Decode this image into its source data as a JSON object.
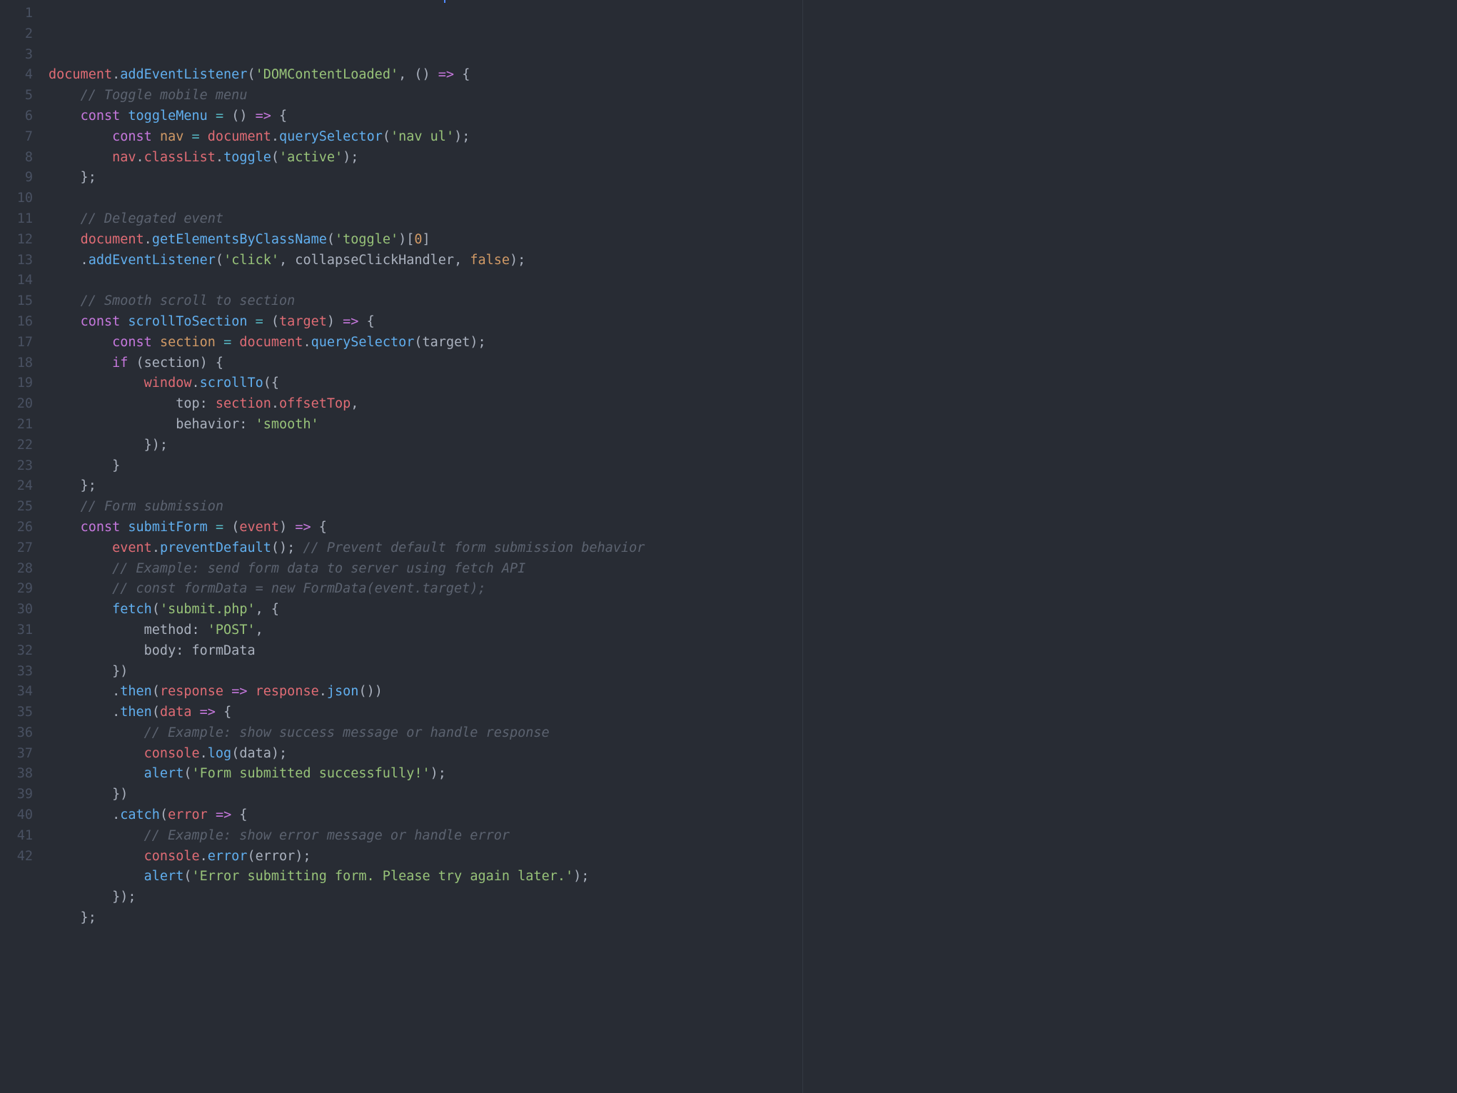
{
  "lines": [
    {
      "n": "1",
      "tokens": [
        [
          "document",
          "t-red"
        ],
        [
          ".",
          "t-punc"
        ],
        [
          "addEventListener",
          "t-blue"
        ],
        [
          "(",
          "t-punc"
        ],
        [
          "'DOMContentLoaded'",
          "t-green"
        ],
        [
          ", () ",
          "t-gray"
        ],
        [
          "=>",
          "t-purple"
        ],
        [
          " {",
          "t-gray"
        ]
      ]
    },
    {
      "n": "2",
      "tokens": [
        [
          "    ",
          "t-gray"
        ],
        [
          "// Toggle mobile menu",
          "t-comment"
        ]
      ]
    },
    {
      "n": "3",
      "tokens": [
        [
          "    ",
          "t-gray"
        ],
        [
          "const",
          "t-purple"
        ],
        [
          " ",
          "t-gray"
        ],
        [
          "toggleMenu",
          "t-blue"
        ],
        [
          " ",
          "t-gray"
        ],
        [
          "=",
          "t-cyan"
        ],
        [
          " () ",
          "t-gray"
        ],
        [
          "=>",
          "t-purple"
        ],
        [
          " {",
          "t-gray"
        ]
      ]
    },
    {
      "n": "4",
      "tokens": [
        [
          "        ",
          "t-gray"
        ],
        [
          "const",
          "t-purple"
        ],
        [
          " ",
          "t-gray"
        ],
        [
          "nav",
          "t-orange"
        ],
        [
          " ",
          "t-gray"
        ],
        [
          "=",
          "t-cyan"
        ],
        [
          " ",
          "t-gray"
        ],
        [
          "document",
          "t-red"
        ],
        [
          ".",
          "t-punc"
        ],
        [
          "querySelector",
          "t-blue"
        ],
        [
          "(",
          "t-punc"
        ],
        [
          "'nav ul'",
          "t-green"
        ],
        [
          ");",
          "t-punc"
        ]
      ]
    },
    {
      "n": "5",
      "tokens": [
        [
          "        ",
          "t-gray"
        ],
        [
          "nav",
          "t-red"
        ],
        [
          ".",
          "t-punc"
        ],
        [
          "classList",
          "t-red"
        ],
        [
          ".",
          "t-punc"
        ],
        [
          "toggle",
          "t-blue"
        ],
        [
          "(",
          "t-punc"
        ],
        [
          "'active'",
          "t-green"
        ],
        [
          ");",
          "t-punc"
        ]
      ]
    },
    {
      "n": "6",
      "tokens": [
        [
          "    };",
          "t-gray"
        ]
      ]
    },
    {
      "n": "7",
      "tokens": [
        [
          "",
          "t-gray"
        ]
      ]
    },
    {
      "n": "8",
      "tokens": [
        [
          "    ",
          "t-gray"
        ],
        [
          "// Delegated event",
          "t-comment"
        ]
      ]
    },
    {
      "n": "9",
      "tokens": [
        [
          "    ",
          "t-gray"
        ],
        [
          "document",
          "t-red"
        ],
        [
          ".",
          "t-punc"
        ],
        [
          "getElementsByClassName",
          "t-blue"
        ],
        [
          "(",
          "t-punc"
        ],
        [
          "'toggle'",
          "t-green"
        ],
        [
          ")[",
          "t-punc"
        ],
        [
          "0",
          "t-orange"
        ],
        [
          "]",
          "t-punc"
        ]
      ]
    },
    {
      "n": "10",
      "tokens": [
        [
          "    .",
          "t-gray"
        ],
        [
          "addEventListener",
          "t-blue"
        ],
        [
          "(",
          "t-punc"
        ],
        [
          "'click'",
          "t-green"
        ],
        [
          ", collapseClickHandler, ",
          "t-gray"
        ],
        [
          "false",
          "t-orange"
        ],
        [
          ");",
          "t-punc"
        ]
      ]
    },
    {
      "n": "11",
      "tokens": [
        [
          "",
          "t-gray"
        ]
      ]
    },
    {
      "n": "12",
      "tokens": [
        [
          "    ",
          "t-gray"
        ],
        [
          "// Smooth scroll to section",
          "t-comment"
        ]
      ]
    },
    {
      "n": "13",
      "tokens": [
        [
          "    ",
          "t-gray"
        ],
        [
          "const",
          "t-purple"
        ],
        [
          " ",
          "t-gray"
        ],
        [
          "scrollToSection",
          "t-blue"
        ],
        [
          " ",
          "t-gray"
        ],
        [
          "=",
          "t-cyan"
        ],
        [
          " (",
          "t-gray"
        ],
        [
          "target",
          "t-red"
        ],
        [
          ") ",
          "t-gray"
        ],
        [
          "=>",
          "t-purple"
        ],
        [
          " {",
          "t-gray"
        ]
      ]
    },
    {
      "n": "14",
      "tokens": [
        [
          "        ",
          "t-gray"
        ],
        [
          "const",
          "t-purple"
        ],
        [
          " ",
          "t-gray"
        ],
        [
          "section",
          "t-orange"
        ],
        [
          " ",
          "t-gray"
        ],
        [
          "=",
          "t-cyan"
        ],
        [
          " ",
          "t-gray"
        ],
        [
          "document",
          "t-red"
        ],
        [
          ".",
          "t-punc"
        ],
        [
          "querySelector",
          "t-blue"
        ],
        [
          "(target);",
          "t-gray"
        ]
      ]
    },
    {
      "n": "15",
      "tokens": [
        [
          "        ",
          "t-gray"
        ],
        [
          "if",
          "t-purple"
        ],
        [
          " (section) {",
          "t-gray"
        ]
      ]
    },
    {
      "n": "16",
      "tokens": [
        [
          "            ",
          "t-gray"
        ],
        [
          "window",
          "t-red"
        ],
        [
          ".",
          "t-punc"
        ],
        [
          "scrollTo",
          "t-blue"
        ],
        [
          "({",
          "t-gray"
        ]
      ]
    },
    {
      "n": "17",
      "tokens": [
        [
          "                top: ",
          "t-gray"
        ],
        [
          "section",
          "t-red"
        ],
        [
          ".",
          "t-punc"
        ],
        [
          "offsetTop",
          "t-red"
        ],
        [
          ",",
          "t-punc"
        ]
      ]
    },
    {
      "n": "18",
      "tokens": [
        [
          "                behavior: ",
          "t-gray"
        ],
        [
          "'smooth'",
          "t-green"
        ]
      ]
    },
    {
      "n": "19",
      "tokens": [
        [
          "            });",
          "t-gray"
        ]
      ]
    },
    {
      "n": "20",
      "tokens": [
        [
          "        }",
          "t-gray"
        ]
      ]
    },
    {
      "n": "21",
      "tokens": [
        [
          "    };",
          "t-gray"
        ]
      ]
    },
    {
      "n": "22",
      "tokens": [
        [
          "    ",
          "t-gray"
        ],
        [
          "// Form submission",
          "t-comment"
        ]
      ]
    },
    {
      "n": "23",
      "tokens": [
        [
          "    ",
          "t-gray"
        ],
        [
          "const",
          "t-purple"
        ],
        [
          " ",
          "t-gray"
        ],
        [
          "submitForm",
          "t-blue"
        ],
        [
          " ",
          "t-gray"
        ],
        [
          "=",
          "t-cyan"
        ],
        [
          " (",
          "t-gray"
        ],
        [
          "event",
          "t-red"
        ],
        [
          ") ",
          "t-gray"
        ],
        [
          "=>",
          "t-purple"
        ],
        [
          " {",
          "t-gray"
        ]
      ]
    },
    {
      "n": "24",
      "tokens": [
        [
          "        ",
          "t-gray"
        ],
        [
          "event",
          "t-red"
        ],
        [
          ".",
          "t-punc"
        ],
        [
          "preventDefault",
          "t-blue"
        ],
        [
          "(); ",
          "t-gray"
        ],
        [
          "// Prevent default form submission behavior",
          "t-comment"
        ]
      ]
    },
    {
      "n": "25",
      "tokens": [
        [
          "        ",
          "t-gray"
        ],
        [
          "// Example: send form data to server using fetch API",
          "t-comment"
        ]
      ]
    },
    {
      "n": "26",
      "tokens": [
        [
          "        ",
          "t-gray"
        ],
        [
          "// const formData = new FormData(event.target);",
          "t-comment"
        ]
      ]
    },
    {
      "n": "27",
      "tokens": [
        [
          "        ",
          "t-gray"
        ],
        [
          "fetch",
          "t-blue"
        ],
        [
          "(",
          "t-punc"
        ],
        [
          "'submit.php'",
          "t-green"
        ],
        [
          ", {",
          "t-gray"
        ]
      ]
    },
    {
      "n": "28",
      "tokens": [
        [
          "            method: ",
          "t-gray"
        ],
        [
          "'POST'",
          "t-green"
        ],
        [
          ",",
          "t-punc"
        ]
      ]
    },
    {
      "n": "29",
      "tokens": [
        [
          "            body: formData",
          "t-gray"
        ]
      ]
    },
    {
      "n": "30",
      "tokens": [
        [
          "        })",
          "t-gray"
        ]
      ]
    },
    {
      "n": "31",
      "tokens": [
        [
          "        .",
          "t-gray"
        ],
        [
          "then",
          "t-blue"
        ],
        [
          "(",
          "t-punc"
        ],
        [
          "response",
          "t-red"
        ],
        [
          " ",
          "t-gray"
        ],
        [
          "=>",
          "t-purple"
        ],
        [
          " ",
          "t-gray"
        ],
        [
          "response",
          "t-red"
        ],
        [
          ".",
          "t-punc"
        ],
        [
          "json",
          "t-blue"
        ],
        [
          "())",
          "t-gray"
        ]
      ]
    },
    {
      "n": "32",
      "tokens": [
        [
          "        .",
          "t-gray"
        ],
        [
          "then",
          "t-blue"
        ],
        [
          "(",
          "t-punc"
        ],
        [
          "data",
          "t-red"
        ],
        [
          " ",
          "t-gray"
        ],
        [
          "=>",
          "t-purple"
        ],
        [
          " {",
          "t-gray"
        ]
      ]
    },
    {
      "n": "33",
      "tokens": [
        [
          "            ",
          "t-gray"
        ],
        [
          "// Example: show success message or handle response",
          "t-comment"
        ]
      ]
    },
    {
      "n": "34",
      "tokens": [
        [
          "            ",
          "t-gray"
        ],
        [
          "console",
          "t-red"
        ],
        [
          ".",
          "t-punc"
        ],
        [
          "log",
          "t-blue"
        ],
        [
          "(data);",
          "t-gray"
        ]
      ]
    },
    {
      "n": "35",
      "tokens": [
        [
          "            ",
          "t-gray"
        ],
        [
          "alert",
          "t-blue"
        ],
        [
          "(",
          "t-punc"
        ],
        [
          "'Form submitted successfully!'",
          "t-green"
        ],
        [
          ");",
          "t-punc"
        ]
      ]
    },
    {
      "n": "36",
      "tokens": [
        [
          "        })",
          "t-gray"
        ]
      ]
    },
    {
      "n": "37",
      "tokens": [
        [
          "        .",
          "t-gray"
        ],
        [
          "catch",
          "t-blue"
        ],
        [
          "(",
          "t-punc"
        ],
        [
          "error",
          "t-red"
        ],
        [
          " ",
          "t-gray"
        ],
        [
          "=>",
          "t-purple"
        ],
        [
          " {",
          "t-gray"
        ]
      ]
    },
    {
      "n": "38",
      "tokens": [
        [
          "            ",
          "t-gray"
        ],
        [
          "// Example: show error message or handle error",
          "t-comment"
        ]
      ]
    },
    {
      "n": "39",
      "tokens": [
        [
          "            ",
          "t-gray"
        ],
        [
          "console",
          "t-red"
        ],
        [
          ".",
          "t-punc"
        ],
        [
          "error",
          "t-blue"
        ],
        [
          "(error);",
          "t-gray"
        ]
      ]
    },
    {
      "n": "40",
      "tokens": [
        [
          "            ",
          "t-gray"
        ],
        [
          "alert",
          "t-blue"
        ],
        [
          "(",
          "t-punc"
        ],
        [
          "'Error submitting form. Please try again later.'",
          "t-green"
        ],
        [
          ");",
          "t-punc"
        ]
      ]
    },
    {
      "n": "41",
      "tokens": [
        [
          "        });",
          "t-gray"
        ]
      ]
    },
    {
      "n": "42",
      "tokens": [
        [
          "    };",
          "t-gray"
        ]
      ]
    }
  ]
}
